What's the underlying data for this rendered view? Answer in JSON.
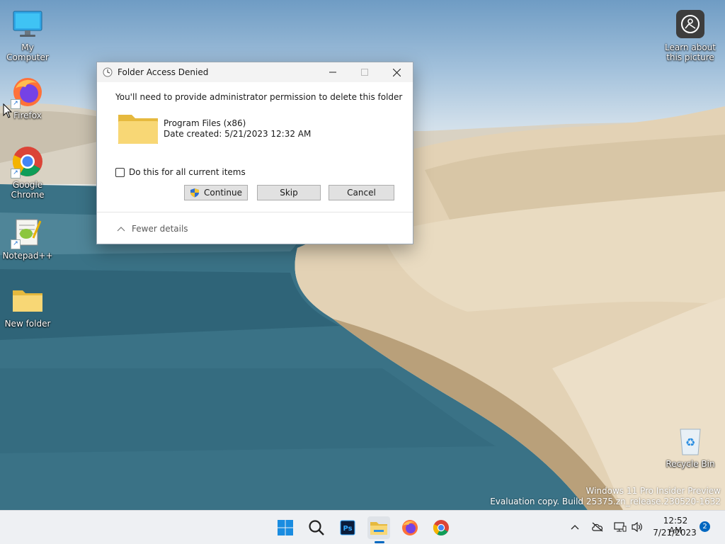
{
  "desktop": {
    "icons": [
      {
        "label": "My Computer"
      },
      {
        "label": "Firefox"
      },
      {
        "label": "Google Chrome"
      },
      {
        "label": "Notepad++"
      },
      {
        "label": "New folder"
      },
      {
        "label": "Learn about this picture"
      },
      {
        "label": "Recycle Bin"
      }
    ],
    "watermark": {
      "line1": "Windows 11 Pro Insider Preview",
      "line2": "Evaluation copy. Build 25375.zn_release.230520-1632"
    }
  },
  "dialog": {
    "title": "Folder Access Denied",
    "message": "You'll need to provide administrator permission to delete this folder",
    "folder_name": "Program Files (x86)",
    "date_created": "Date created: 5/21/2023 12:32 AM",
    "checkbox_label": "Do this for all current items",
    "checkbox_checked": false,
    "buttons": {
      "continue": "Continue",
      "skip": "Skip",
      "cancel": "Cancel"
    },
    "details_toggle": "Fewer details"
  },
  "taskbar": {
    "apps": [
      "start-icon",
      "search-icon",
      "photoshop-icon",
      "file-explorer-icon",
      "firefox-icon",
      "chrome-icon"
    ],
    "active_app": "file-explorer-icon",
    "clock": {
      "time": "12:52 AM",
      "date": "7/21/2023"
    },
    "notification_count": "2"
  },
  "colors": {
    "accent": "#0067c0",
    "folder": "#f8d775",
    "dialog_button": "#e1e1e1"
  }
}
